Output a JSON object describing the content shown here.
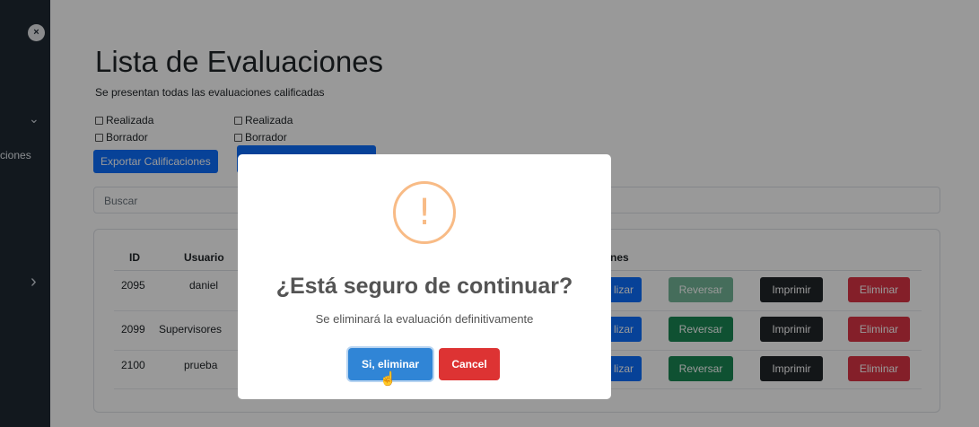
{
  "sidebar": {
    "close_icon": "×",
    "chevron_down": "⌄",
    "chevron_right": "›",
    "partial_label": "ciones"
  },
  "header": {
    "title": "Lista de Evaluaciones",
    "subtitle": "Se presentan todas las evaluaciones calificadas"
  },
  "filters": {
    "group1": [
      "Realizada",
      "Borrador"
    ],
    "group2": [
      "Realizada",
      "Borrador"
    ]
  },
  "toolbar": {
    "export_label": "Exportar Calificaciones"
  },
  "search": {
    "placeholder": "Buscar"
  },
  "table": {
    "headers": [
      "ID",
      "Usuario",
      "nes"
    ],
    "rows": [
      {
        "id": "2095",
        "usuario": "daniel",
        "btn1": "lizar",
        "btn2": "Reversar",
        "btn3": "Imprimir",
        "btn4": "Eliminar"
      },
      {
        "id": "2099",
        "usuario": "Supervisores",
        "btn1": "lizar",
        "btn2": "Reversar",
        "btn3": "Imprimir",
        "btn4": "Eliminar"
      },
      {
        "id": "2100",
        "usuario": "prueba",
        "btn1": "lizar",
        "btn2": "Reversar",
        "btn3": "Imprimir",
        "btn4": "Eliminar"
      }
    ]
  },
  "modal": {
    "icon": "!",
    "title": "¿Está seguro de continuar?",
    "text": "Se eliminará la evaluación definitivamente",
    "confirm_label": "Si, eliminar",
    "cancel_label": "Cancel"
  },
  "colors": {
    "sidebar": "#1e2833",
    "primary": "#0d6efd",
    "success": "#198754",
    "dark": "#212529",
    "danger": "#dc3545",
    "warning_icon": "#f8bb86",
    "confirm": "#3085d6",
    "cancel": "#dd3333"
  }
}
